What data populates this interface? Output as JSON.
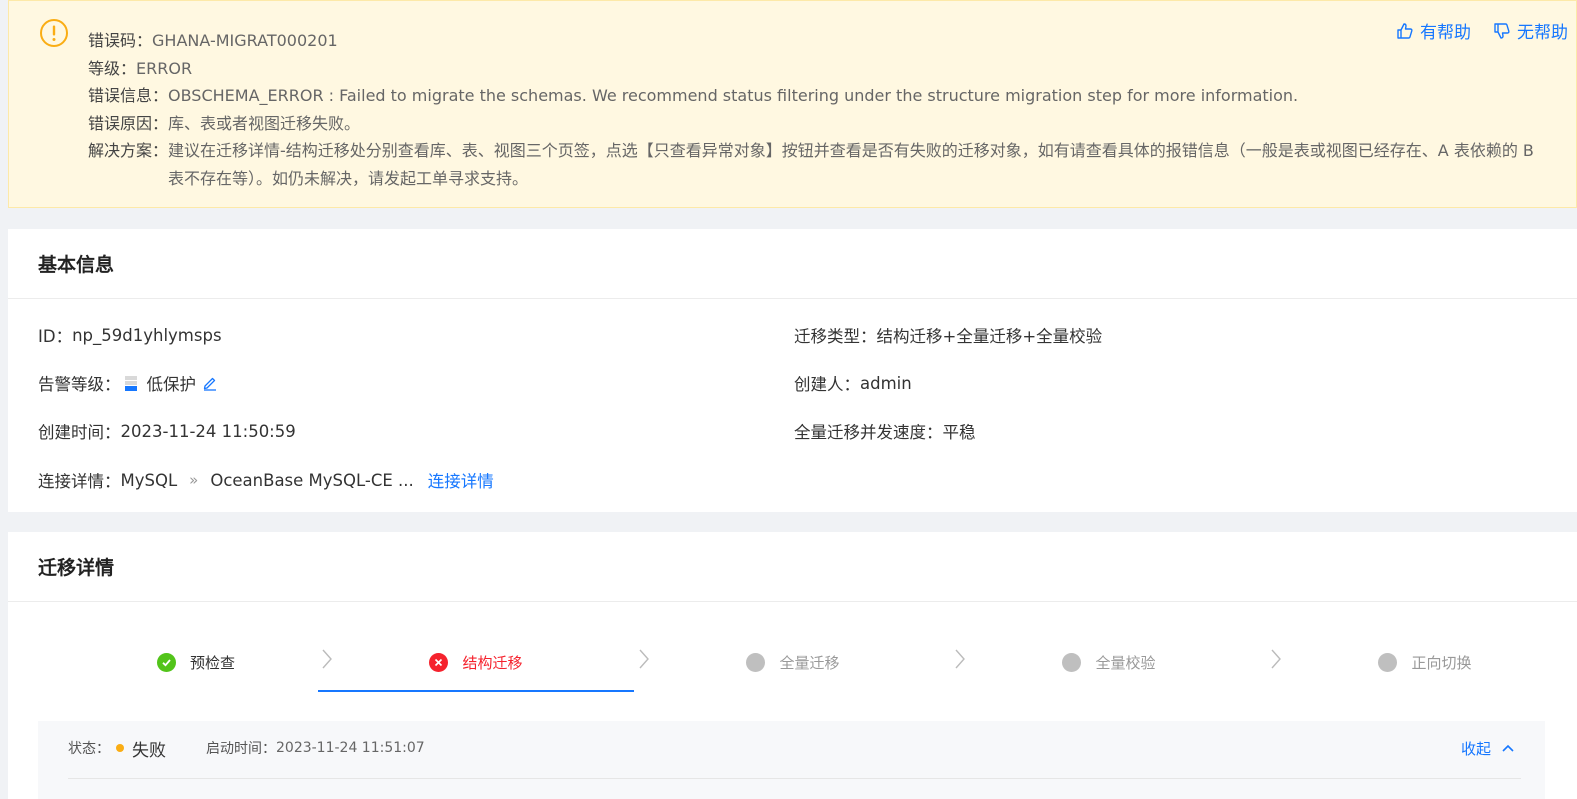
{
  "alert": {
    "code_label": "错误码：",
    "code": "GHANA-MIGRAT000201",
    "level_label": "等级：",
    "level": "ERROR",
    "message_label": "错误信息：",
    "message": "OBSCHEMA_ERROR : Failed to migrate the schemas. We recommend status filtering under the structure migration step for more information.",
    "reason_label": "错误原因：",
    "reason": "库、表或者视图迁移失败。",
    "solution_label": "解决方案：",
    "solution": "建议在迁移详情-结构迁移处分别查看库、表、视图三个页签，点选【只查看异常对象】按钮并查看是否有失败的迁移对象，如有请查看具体的报错信息（一般是表或视图已经存在、A 表依赖的 B 表不存在等）。如仍未解决，请发起工单寻求支持。",
    "helpful": "有帮助",
    "not_helpful": "无帮助",
    "accent": "#faad14"
  },
  "basic": {
    "title": "基本信息",
    "id_label": "ID：",
    "id": "np_59d1yhlymsps",
    "alarm_label": "告警等级：",
    "alarm": "低保护",
    "created_label": "创建时间：",
    "created": "2023-11-24 11:50:59",
    "conn_label": "连接详情：",
    "conn_source": "MySQL",
    "conn_target": "OceanBase MySQL-CE ...",
    "conn_link": "连接详情",
    "type_label": "迁移类型：",
    "type": "结构迁移+全量迁移+全量校验",
    "creator_label": "创建人：",
    "creator": "admin",
    "speed_label": "全量迁移并发速度：",
    "speed": "平稳"
  },
  "detail": {
    "title": "迁移详情",
    "steps": [
      {
        "label": "预检查",
        "status": "done"
      },
      {
        "label": "结构迁移",
        "status": "error"
      },
      {
        "label": "全量迁移",
        "status": "wait"
      },
      {
        "label": "全量校验",
        "status": "wait"
      },
      {
        "label": "正向切换",
        "status": "wait"
      }
    ],
    "status_label": "状态：",
    "status": "失败",
    "start_label": "启动时间：",
    "start": "2023-11-24 11:51:07",
    "collapse": "收起"
  }
}
